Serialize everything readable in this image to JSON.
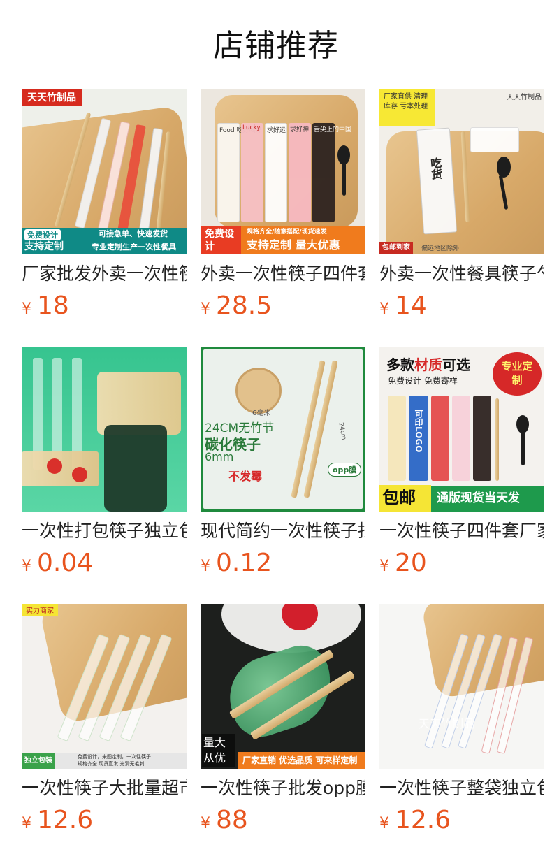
{
  "header": {
    "title": "店铺推荐"
  },
  "currency": "¥",
  "products": [
    {
      "name": "厂家批发外卖一次性筷子",
      "price": "18",
      "thumb": {
        "brand": "天天竹制品",
        "badge1": "免费设计",
        "badge2": "支持定制",
        "badge3": "可接急单、快速发货",
        "badge4": "专业定制生产一次性餐具"
      }
    },
    {
      "name": "外卖一次性筷子四件套",
      "price": "28.5",
      "thumb": {
        "banner_left": "免费设计",
        "banner_right": "支持定制 量大优惠",
        "banner_small": "规格齐全/随意搭配/现货速发",
        "pack1": "Food 吃好喝好",
        "pack2": "Lucky",
        "pack3": "求好运",
        "pack4": "求好神",
        "pack5": "舌尖上的中国"
      }
    },
    {
      "name": "外卖一次性餐具筷子勺子",
      "price": "14",
      "thumb": {
        "corner": "厂家直供 清理库存 亏本处理",
        "brand": "天天竹制品",
        "pack_text": "吃货",
        "footer1": "包邮到家",
        "footer2": "偏远地区除外"
      }
    },
    {
      "name": "一次性打包筷子独立包装",
      "price": "0.04",
      "thumb": {}
    },
    {
      "name": "现代简约一次性筷子批发",
      "price": "0.12",
      "thumb": {
        "size_label": "6毫米",
        "spec1": "24CM无竹节",
        "spec2": "碳化筷子",
        "spec3": "6mm",
        "feature": "不发霉",
        "length": "24cm",
        "film": "opp膜"
      }
    },
    {
      "name": "一次性筷子四件套厂家直销",
      "price": "20",
      "thumb": {
        "headline_a": "多款",
        "headline_b": "材质",
        "headline_c": "可选",
        "sub": "免费设计  免费寄样",
        "stamp": "专业定制",
        "logo_pack": "可印LOGO",
        "footer_a": "包邮",
        "footer_b": "通版现货当天发"
      }
    },
    {
      "name": "一次性筷子大批量超市",
      "price": "12.6",
      "thumb": {
        "tag": "实力商家",
        "footer1": "独立包装",
        "footer2": "免费设计，来图定制，一次性筷子",
        "footer3": "规格齐全  现货直发  光滑无毛刺"
      }
    },
    {
      "name": "一次性筷子批发opp膜独立包装",
      "price": "88",
      "thumb": {
        "corner": "量大从优",
        "footer": "厂家直销 优选品质 可来样定制"
      }
    },
    {
      "name": "一次性筷子整袋独立包装",
      "price": "12.6",
      "thumb": {
        "watermark": "天天竹制品"
      }
    }
  ],
  "colors": {
    "price": "#e8541e",
    "title": "#111111",
    "accent_green": "#2f8f3a"
  }
}
